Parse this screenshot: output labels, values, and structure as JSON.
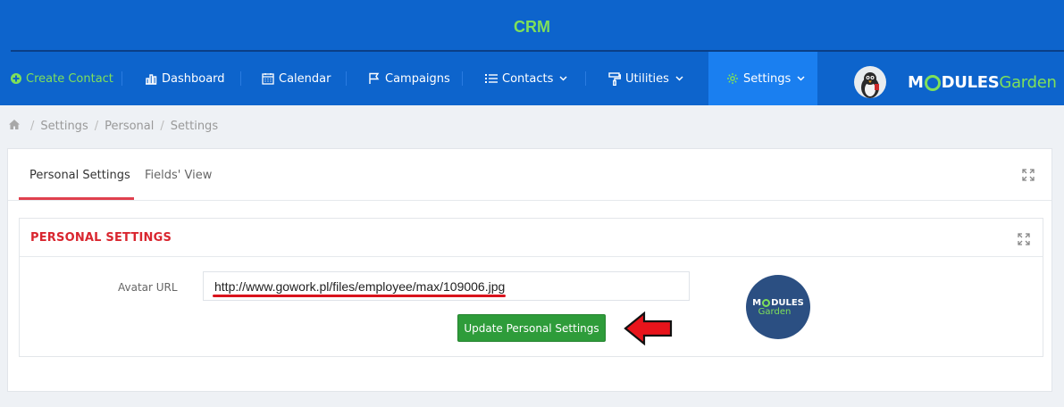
{
  "app": {
    "title": "CRM",
    "brand_before": "M",
    "brand_after": "DULES",
    "brand_garden": "Garden"
  },
  "nav": {
    "items": [
      {
        "label": "Create Contact",
        "icon": "plus-circle-icon"
      },
      {
        "label": "Dashboard",
        "icon": "bar-chart-icon"
      },
      {
        "label": "Calendar",
        "icon": "calendar-icon"
      },
      {
        "label": "Campaigns",
        "icon": "flag-icon"
      },
      {
        "label": "Contacts",
        "icon": "list-icon",
        "dropdown": true
      },
      {
        "label": "Utilities",
        "icon": "paint-roller-icon",
        "dropdown": true
      },
      {
        "label": "Settings",
        "icon": "gear-icon",
        "dropdown": true,
        "active": true
      }
    ]
  },
  "breadcrumb": {
    "home_icon": "home-icon",
    "items": [
      "Settings",
      "Personal",
      "Settings"
    ]
  },
  "tabs": [
    {
      "label": "Personal Settings",
      "active": true
    },
    {
      "label": "Fields' View",
      "active": false
    }
  ],
  "panel": {
    "title": "PERSONAL SETTINGS",
    "avatar_label": "Avatar URL",
    "avatar_value": "http://www.gowork.pl/files/employee/max/109006.jpg",
    "submit_label": "Update Personal Settings",
    "avatar_logo_top_before": "M",
    "avatar_logo_top_after": "DULES",
    "avatar_logo_bottom": "Garden"
  },
  "colors": {
    "header": "#0d64cc",
    "accent_green": "#7fe05a",
    "active_nav": "#1a7ff0",
    "title_red": "#d9262f",
    "button_green": "#2e9c3a"
  }
}
